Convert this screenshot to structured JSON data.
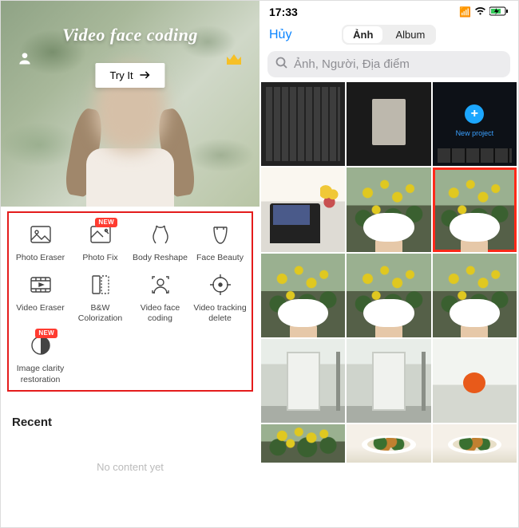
{
  "left": {
    "hero_title": "Video face coding",
    "try_label": "Try It",
    "tools": [
      {
        "label": "Photo Eraser",
        "new": false
      },
      {
        "label": "Photo Fix",
        "new": true
      },
      {
        "label": "Body Reshape",
        "new": false
      },
      {
        "label": "Face Beauty",
        "new": false
      },
      {
        "label": "Video Eraser",
        "new": false
      },
      {
        "label": "B&W Colorization",
        "new": false
      },
      {
        "label": "Video face coding",
        "new": false
      },
      {
        "label": "Video tracking delete",
        "new": false
      },
      {
        "label": "Image clarity restoration",
        "new": true
      }
    ],
    "new_badge": "NEW",
    "recent_label": "Recent",
    "no_content": "No content yet"
  },
  "right": {
    "time": "17:33",
    "cancel": "Hủy",
    "tabs": {
      "photo": "Ảnh",
      "album": "Album"
    },
    "search_placeholder": "Ảnh, Người, Địa điểm",
    "new_project": "New project"
  }
}
